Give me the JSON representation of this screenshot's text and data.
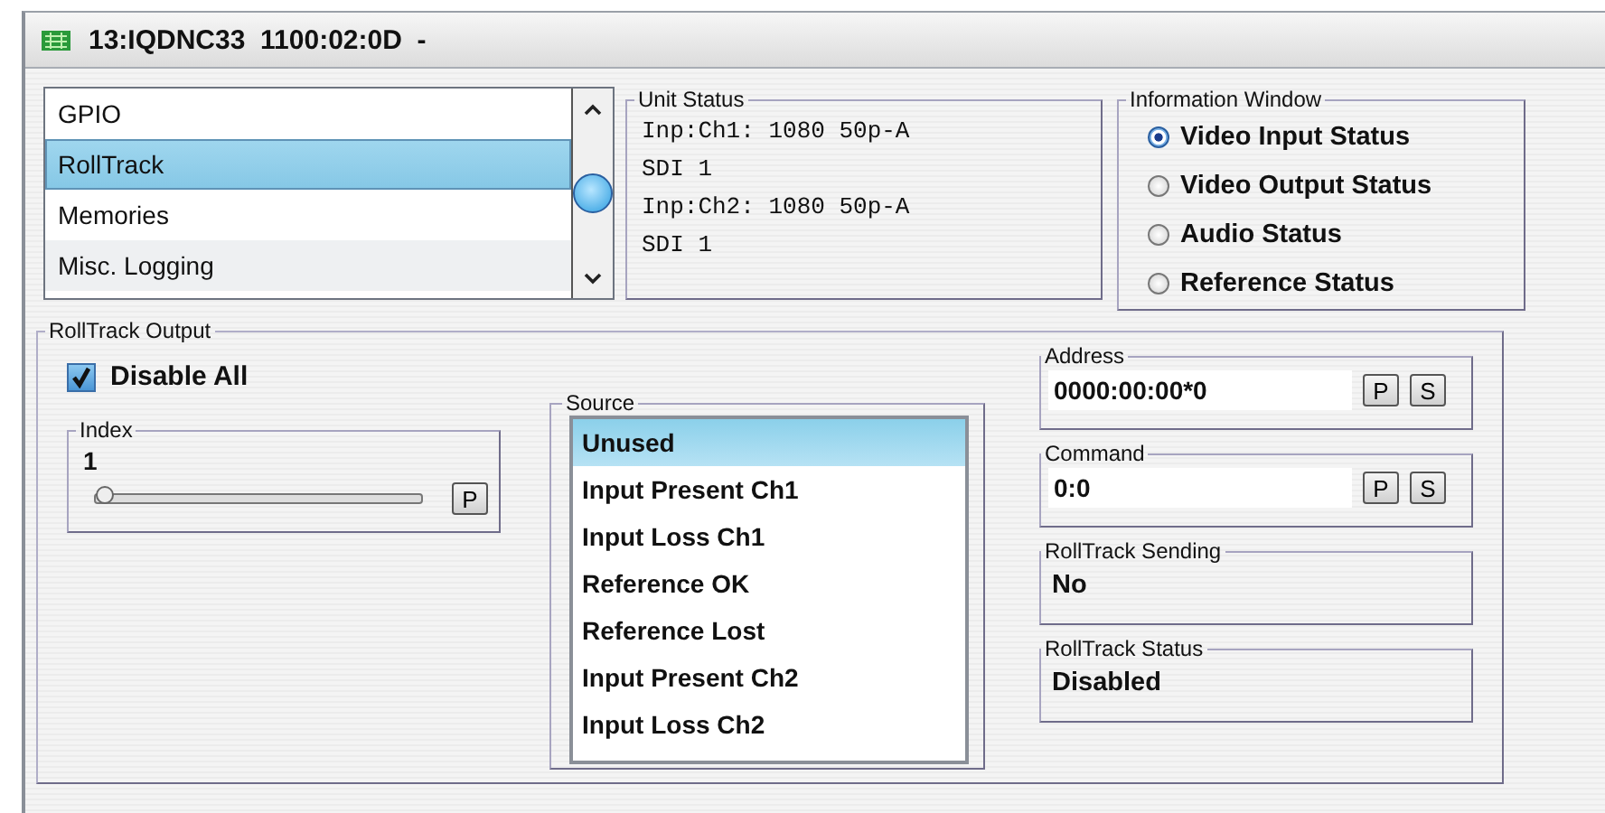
{
  "window": {
    "title": "13:IQDNC33  1100:02:0D  -"
  },
  "menu_list": {
    "items": [
      {
        "label": "GPIO",
        "selected": false
      },
      {
        "label": "RollTrack",
        "selected": true
      },
      {
        "label": "Memories",
        "selected": false
      },
      {
        "label": "Misc. Logging",
        "selected": false
      }
    ]
  },
  "unit_status": {
    "title": "Unit Status",
    "lines": [
      "Inp:Ch1: 1080 50p-A",
      "SDI 1",
      "Inp:Ch2: 1080 50p-A",
      "SDI 1"
    ]
  },
  "information_window": {
    "title": "Information Window",
    "options": [
      {
        "label": "Video Input Status",
        "selected": true
      },
      {
        "label": "Video Output Status",
        "selected": false
      },
      {
        "label": "Audio Status",
        "selected": false
      },
      {
        "label": "Reference Status",
        "selected": false
      }
    ]
  },
  "rolltrack_output": {
    "title": "RollTrack Output",
    "disable_all": {
      "label": "Disable All",
      "checked": true
    },
    "index": {
      "title": "Index",
      "value": "1",
      "level": 0,
      "button": "P"
    },
    "source": {
      "title": "Source",
      "items": [
        {
          "label": "Unused",
          "selected": true
        },
        {
          "label": "Input Present Ch1",
          "selected": false
        },
        {
          "label": "Input Loss Ch1",
          "selected": false
        },
        {
          "label": "Reference OK",
          "selected": false
        },
        {
          "label": "Reference Lost",
          "selected": false
        },
        {
          "label": "Input Present Ch2",
          "selected": false
        },
        {
          "label": "Input Loss Ch2",
          "selected": false
        }
      ]
    },
    "fields": [
      {
        "kind": "input",
        "title": "Address",
        "value": "0000:00:00*0",
        "buttons": [
          "P",
          "S"
        ]
      },
      {
        "kind": "input",
        "title": "Command",
        "value": "0:0",
        "buttons": [
          "P",
          "S"
        ]
      },
      {
        "kind": "readout",
        "title": "RollTrack Sending",
        "value": "No"
      },
      {
        "kind": "readout",
        "title": "RollTrack Status",
        "value": "Disabled"
      }
    ]
  }
}
